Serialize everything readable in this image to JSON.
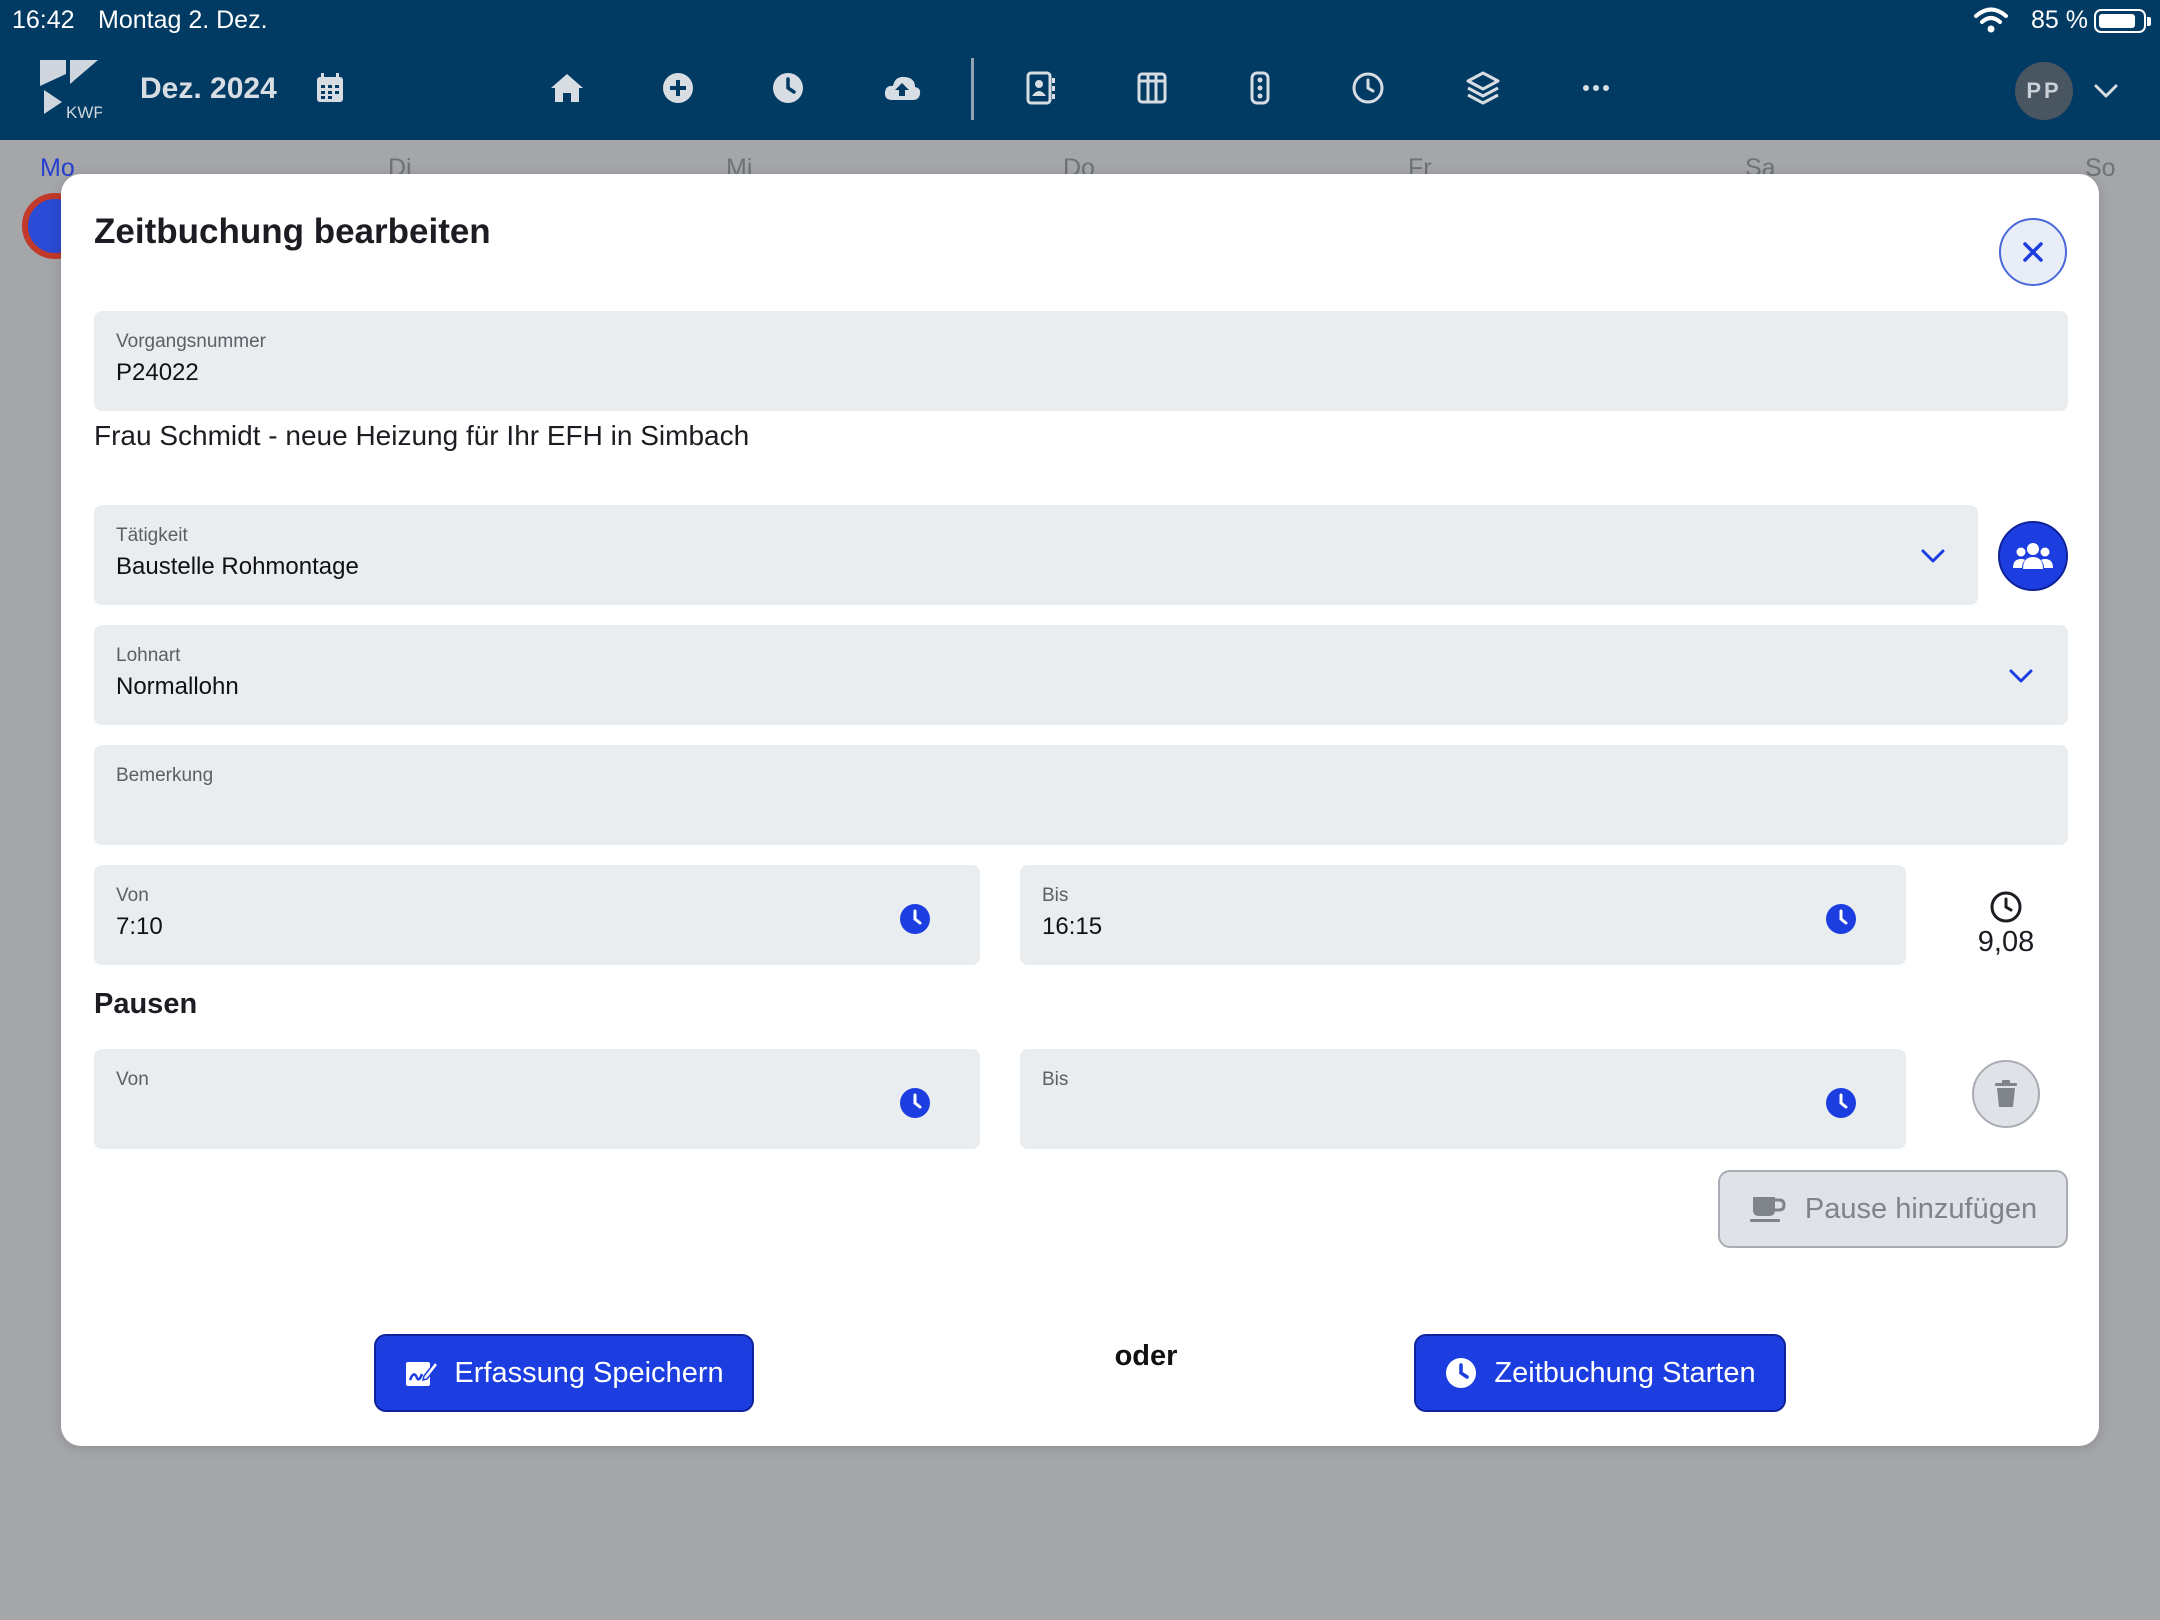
{
  "status_bar": {
    "time": "16:42",
    "date": "Montag 2. Dez.",
    "battery": "85 %",
    "battery_level": 0.85
  },
  "header": {
    "logo_text": "KWP",
    "month": "Dez. 2024",
    "icons": [
      "calendar-icon",
      "home-icon",
      "plus-circle-icon",
      "clock-icon",
      "cloud-upload-icon",
      "contact-icon",
      "columns-icon",
      "traffic-light-icon",
      "history-clock-icon",
      "layers-icon",
      "more-icon"
    ],
    "avatar_initials": "PP"
  },
  "week": {
    "days": [
      "Mo",
      "Di",
      "Mi",
      "Do",
      "Fr",
      "Sa",
      "So"
    ],
    "active_day": "Mo"
  },
  "modal": {
    "title": "Zeitbuchung bearbeiten",
    "vorgang": {
      "label": "Vorgangsnummer",
      "value": "P24022"
    },
    "description": "Frau Schmidt - neue Heizung für Ihr EFH in Simbach",
    "taetigkeit": {
      "label": "Tätigkeit",
      "value": "Baustelle Rohmontage"
    },
    "lohnart": {
      "label": "Lohnart",
      "value": "Normallohn"
    },
    "bemerkung": {
      "label": "Bemerkung",
      "value": ""
    },
    "von": {
      "label": "Von",
      "value": "7:10"
    },
    "bis": {
      "label": "Bis",
      "value": "16:15"
    },
    "duration": "9,08",
    "pausen_heading": "Pausen",
    "pause_von": {
      "label": "Von",
      "value": ""
    },
    "pause_bis": {
      "label": "Bis",
      "value": ""
    },
    "pause_add_label": "Pause hinzufügen",
    "save_label": "Erfassung Speichern",
    "or_label": "oder",
    "start_label": "Zeitbuchung Starten"
  },
  "colors": {
    "header_bg": "#013a63",
    "primary": "#1c3ee0",
    "field_bg": "#eaedf0",
    "overlay": "#a4a6a9"
  }
}
